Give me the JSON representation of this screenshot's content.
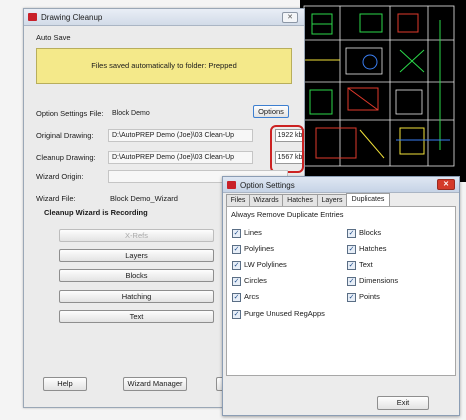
{
  "main_window": {
    "title": "Drawing Cleanup",
    "close_glyph": "✕",
    "auto_save_label": "Auto Save",
    "auto_save_message": "Files saved automatically to folder: Prepped",
    "option_settings_label": "Option Settings File:",
    "option_settings_value": "Block Demo",
    "options_button": "Options",
    "original_drawing_label": "Original Drawing:",
    "original_drawing_value": "D:\\AutoPREP Demo (Joe)\\03 Clean-Up",
    "original_size": "1922 kb",
    "cleanup_drawing_label": "Cleanup Drawing:",
    "cleanup_drawing_value": "D:\\AutoPREP Demo (Joe)\\03 Clean-Up",
    "cleanup_size": "1567 kb",
    "wizard_origin_label": "Wizard Origin:",
    "wizard_origin_value": "",
    "wizard_file_label": "Wizard File:",
    "wizard_file_value": "Block Demo_Wizard",
    "recording_status": "Cleanup Wizard is Recording",
    "wizard_buttons": [
      "X-Refs",
      "Layers",
      "Blocks",
      "Hatching",
      "Text"
    ],
    "help_button": "Help",
    "wizard_manager_button": "Wizard Manager"
  },
  "option_window": {
    "title": "Option Settings",
    "close_glyph": "✕",
    "tabs": [
      "Files",
      "Wizards",
      "Hatches",
      "Layers",
      "Duplicates"
    ],
    "active_tab": "Duplicates",
    "section_heading": "Always Remove Duplicate Entries",
    "left_checkboxes": [
      "Lines",
      "Polylines",
      "LW Polylines",
      "Circles",
      "Arcs"
    ],
    "right_checkboxes": [
      "Blocks",
      "Hatches",
      "Text",
      "Dimensions",
      "Points"
    ],
    "purge_checkbox": "Purge Unused RegApps",
    "check_glyph": "✓",
    "exit_button": "Exit"
  },
  "colors": {
    "banner": "#f4e98a",
    "highlight": "#cc2222",
    "cad_background": "#000000"
  }
}
